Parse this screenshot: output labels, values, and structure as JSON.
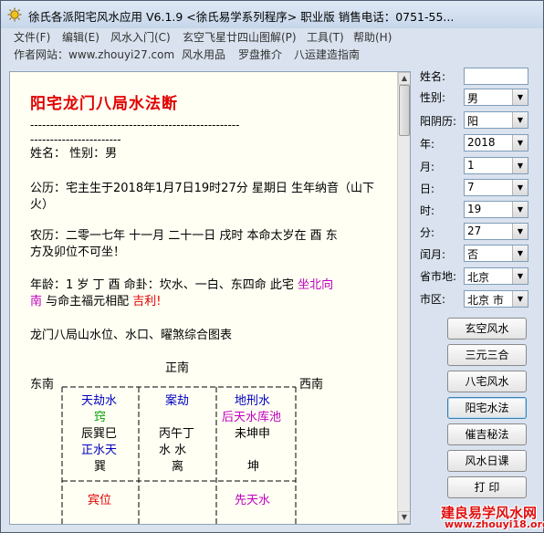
{
  "window": {
    "title": "徐氏各派阳宅风水应用 V6.1.9 <徐氏易学系列程序> 职业版 销售电话：0751-55..."
  },
  "menu": [
    "文件(F)",
    "编辑(E)",
    "风水入门(C)",
    "玄空飞星廿四山图解(P)",
    "工具(T)",
    "帮助(H)"
  ],
  "links": [
    "作者网站：www.zhouyi27.com",
    "风水用品",
    "罗盘推介",
    "八运建造指南"
  ],
  "doc": {
    "heading": "阳宅龙门八局水法断",
    "separator1": "-----------------------------------------------------",
    "separator2": "-----------------------",
    "name_line": "姓名：  性别：男",
    "solar_line1": "公历：宅主生于2018年1月7日19时27分  星期日  生年纳音（山下",
    "solar_line2": "火）",
    "lunar_line1": "农历：二零一七年  十一月  二十一日  戌时    本命太岁在  酉    东",
    "lunar_line2": "方及卯位不可坐！",
    "age_line1_a": "年龄：1 岁    丁  酉    命卦：坎水、一白、东四命    此宅 ",
    "age_line1_b": "坐北向",
    "age_line2_a": "南",
    "age_line2_b": " 与命主福元相配 ",
    "age_line2_c": "吉利!",
    "chart_title": "龙门八局山水位、水口、曜煞综合图表",
    "dir_south": "正南",
    "dir_se": "东南",
    "dir_sw": "西南",
    "grid": {
      "c1": [
        "天劫水",
        "窍",
        "辰巽巳",
        "正水天",
        "巽"
      ],
      "c2": [
        "案劫",
        "丙午丁",
        "水  水",
        "离"
      ],
      "c3": [
        "地刑水",
        "后天水库池",
        "未坤申",
        "坤"
      ],
      "b1": "宾位",
      "b3": "先天水"
    }
  },
  "form": {
    "labels": [
      "姓名:",
      "性别:",
      "阳阴历:",
      "年:",
      "月:",
      "日:",
      "时:",
      "分:",
      "闰月:",
      "省市地:",
      "市区:"
    ],
    "name_value": "",
    "gender": "男",
    "calendar": "阳",
    "year": "2018",
    "month": "1",
    "day": "7",
    "hour": "19",
    "minute": "27",
    "leap": "否",
    "province": "北京",
    "district": "北京 市"
  },
  "buttons": [
    "玄空风水",
    "三元三合",
    "八宅风水",
    "阳宅水法",
    "催吉秘法",
    "风水日课",
    "打 印"
  ],
  "watermark": {
    "line1": "建良易学风水网",
    "line2": "www.zhouyi18.org"
  },
  "colors": {
    "heading": "#e00000",
    "purple": "#c000c0",
    "blue": "#0000c0",
    "green": "#00a000"
  }
}
